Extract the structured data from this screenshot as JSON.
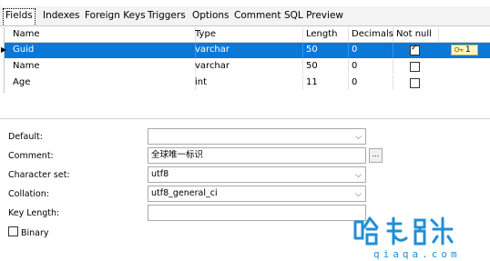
{
  "tabs": [
    "Fields",
    "Indexes",
    "Foreign Keys",
    "Triggers",
    "Options",
    "Comment",
    "SQL Preview"
  ],
  "active_tab": "Fields",
  "columns": [
    "Name",
    "Type",
    "Length",
    "Decimals",
    "Not null"
  ],
  "rows": [
    {
      "name": "Guid",
      "type": "varchar",
      "length": "50",
      "decimals": "0",
      "not_null": true,
      "selected": true,
      "key": "1"
    },
    {
      "name": "Name",
      "type": "varchar",
      "length": "50",
      "decimals": "0",
      "not_null": false
    },
    {
      "name": "Age",
      "type": "int",
      "length": "11",
      "decimals": "0",
      "not_null": false
    }
  ],
  "props": {
    "default_label": "Default:",
    "default_value": "",
    "comment_label": "Comment:",
    "comment_value": "全球唯一标识",
    "comment_button": "...",
    "charset_label": "Character set:",
    "charset_value": "utf8",
    "collation_label": "Collation:",
    "collation_value": "utf8_general_ci",
    "keylength_label": "Key Length:",
    "keylength_value": "",
    "binary_label": "Binary",
    "binary_checked": false
  },
  "watermark": {
    "text": "哈卡瑞",
    "url": "qiaqa.com",
    "color": "#1e8fd6"
  },
  "colors": {
    "selection": "#0a78d7",
    "key_badge": "#fff7c4"
  }
}
